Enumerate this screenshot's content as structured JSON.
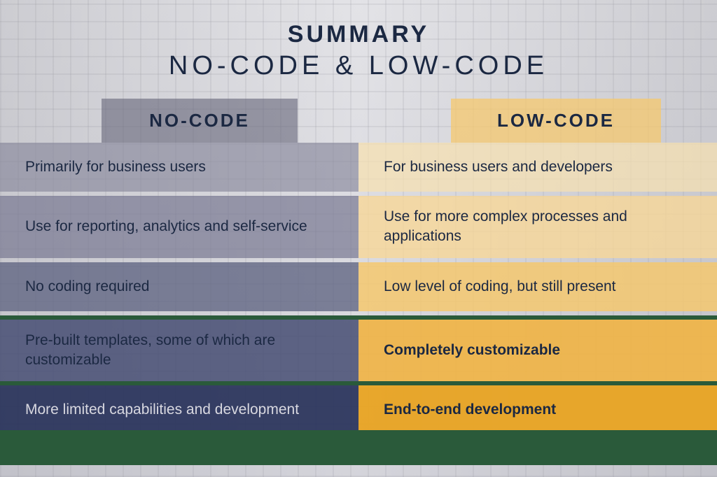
{
  "header": {
    "title_main": "SUMMARY",
    "title_sub": "NO-CODE & LOW-CODE"
  },
  "columns": {
    "left_label": "NO-CODE",
    "right_label": "LOW-CODE"
  },
  "rows": [
    {
      "left": "Primarily for business users",
      "right": "For business users and developers"
    },
    {
      "left": "Use for reporting, analytics and self-service",
      "right": "Use for more complex processes and applications"
    },
    {
      "left": "No coding required",
      "right": "Low level of coding, but still present"
    },
    {
      "left": "Pre-built templates, some of which are customizable",
      "right": "Completely customizable"
    },
    {
      "left": "More limited capabilities and development",
      "right": "End-to-end development"
    }
  ]
}
